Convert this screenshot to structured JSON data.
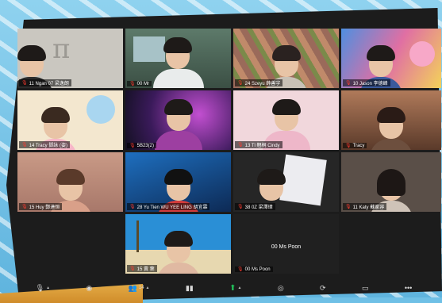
{
  "participants": [
    {
      "name": "11 Ngan 07 梁逸朗",
      "scene": "#c9c6bf",
      "hair": "#222",
      "shirt": "#2c2c2c",
      "extra": "π"
    },
    {
      "name": "00 Mr",
      "scene": "#4f6b5a",
      "hair": "#1b1b1b",
      "shirt": "#e9ecec",
      "active": true
    },
    {
      "name": "24 Szeyu 薛善宇",
      "scene": "#9c6b5a",
      "hair": "#2a2220",
      "shirt": "#c9c1b6"
    },
    {
      "name": "10 Jason 李德峰",
      "scene": "#6fa0d8",
      "hair": "#1f1b18",
      "shirt": "#3b5a9c"
    },
    {
      "name": "14 Tracy 鄧詠 (姿)",
      "scene": "#f3e7cf",
      "hair": "#3a2a20",
      "shirt": "#f7b6c8"
    },
    {
      "name": "5B23(2)",
      "scene": "#4a2a6a",
      "hair": "#2a1e1a",
      "shirt": "#9d3fa1"
    },
    {
      "name": "13 Tl 翹桐 Cindy",
      "scene": "#f1d7dc",
      "hair": "#231b18",
      "shirt": "#eeb7c9"
    },
    {
      "name": "Tracy",
      "scene": "#7a5a4a",
      "hair": "#2a1b16",
      "shirt": "#6d4f3e"
    },
    {
      "name": "15 Huy 鄭達恒",
      "scene": "#b98c78",
      "hair": "#5a3a2a",
      "shirt": "#d9a089"
    },
    {
      "name": "28 Yu Tien WU YEE LING 胡宜霖",
      "scene": "#1e6fbf",
      "hair": "#111",
      "shirt": "#d33c3c"
    },
    {
      "name": "38 0Z 梁澤璋",
      "scene": "#e9e9ec",
      "hair": "#1b1b1b",
      "shirt": "#262626"
    },
    {
      "name": "11 Katy 蘇家容",
      "scene": "#5a4f48",
      "hair": "#1d1715",
      "shirt": "#cfc3b8"
    },
    {
      "name": "15 黃 葉",
      "scene": "#2a8fd6",
      "hair": "#221a16",
      "shirt": "#e0b9a2"
    },
    {
      "name": "00 Ms Poon",
      "scene": "#202020",
      "label": "00 Ms Poon"
    }
  ],
  "toolbar": {
    "participants_count": "14",
    "icons": [
      "mic-icon",
      "video-icon",
      "participants-icon",
      "polls-icon",
      "share-icon",
      "chat-icon",
      "reactions-icon",
      "breakout-icon",
      "apps-icon",
      "more-icon"
    ]
  }
}
